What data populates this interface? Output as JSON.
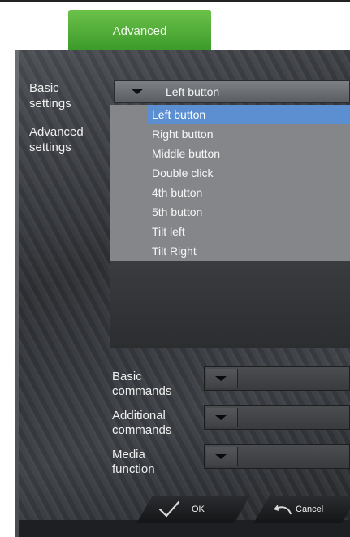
{
  "tab": {
    "label": "Advanced"
  },
  "nav": {
    "basic_settings": "Basic\nsettings",
    "advanced_settings": "Advanced\nsettings"
  },
  "button_select": {
    "selected": "Left button",
    "options": [
      "Left button",
      "Right button",
      "Middle button",
      "Double click",
      "4th button",
      "5th button",
      "Tilt left",
      "Tilt Right"
    ]
  },
  "commands": {
    "basic": "Basic\ncommands",
    "additional": "Additional\ncommands",
    "media": "Media\nfunction"
  },
  "footer": {
    "ok_label": "OK",
    "cancel_label": "Cancel"
  },
  "colors": {
    "tab_green": "#4caf36",
    "selected_blue": "#5b8fd1",
    "list_bg": "#858689"
  },
  "icons": {
    "ok": "checkmark-icon",
    "cancel": "undo-arrow-icon",
    "dropdown": "caret-down-icon"
  }
}
